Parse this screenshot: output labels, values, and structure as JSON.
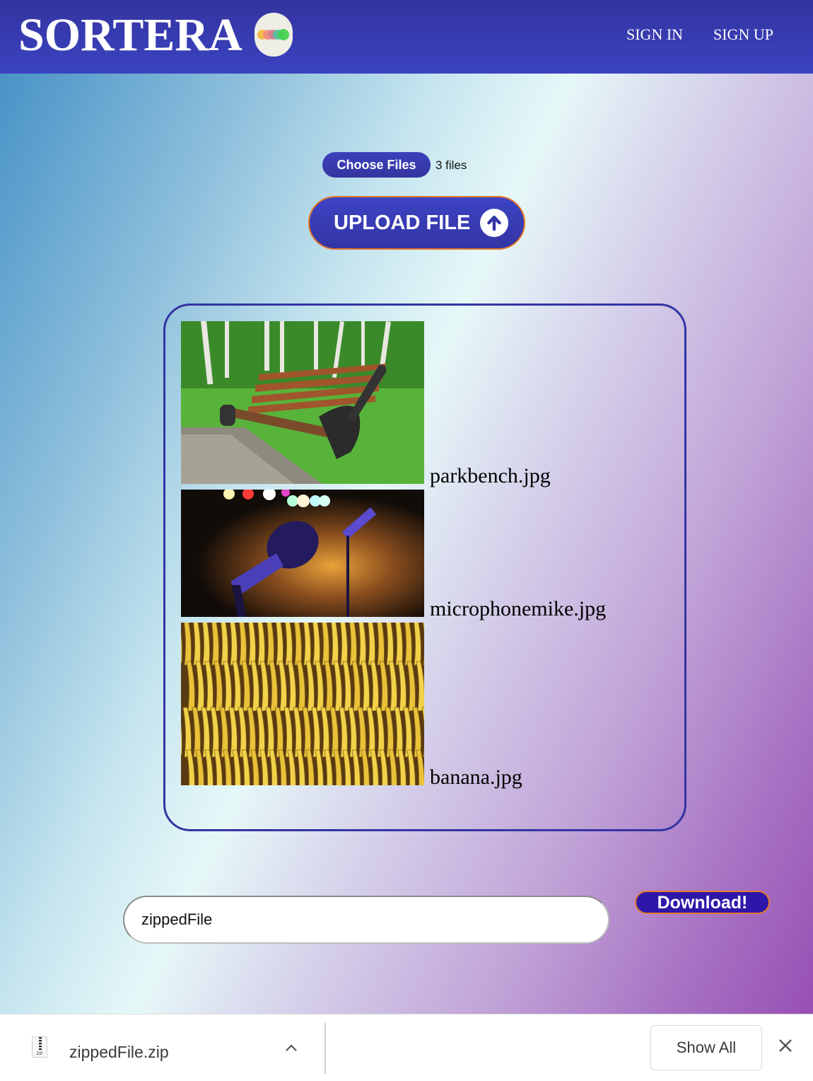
{
  "header": {
    "brand": "SORTERA",
    "logo_dot_colors": [
      "#f4b63a",
      "#ef8a7a",
      "#d47a8e",
      "#4cc3a0",
      "#3fcf4a"
    ],
    "nav": [
      {
        "label": "SIGN IN"
      },
      {
        "label": "SIGN UP"
      }
    ]
  },
  "upload": {
    "choose_label": "Choose Files",
    "files_status": "3 files",
    "upload_label": "UPLOAD FILE",
    "upload_icon": "arrow-up-circle-icon"
  },
  "gallery": {
    "items": [
      {
        "filename": "parkbench.jpg",
        "image": "park bench photo"
      },
      {
        "filename": "microphonemike.jpg",
        "image": "microphone on stage photo"
      },
      {
        "filename": "banana.jpg",
        "image": "bananas bunches photo"
      }
    ]
  },
  "download": {
    "zip_name_value": "zippedFile",
    "button_label": "Download!"
  },
  "download_bar": {
    "file_icon": "zip-file-icon",
    "file_icon_label": "ZIP",
    "filename": "zippedFile.zip",
    "chevron": "^",
    "show_all_label": "Show All",
    "close_glyph": "✕"
  },
  "colors": {
    "brand_blue": "#3434a3",
    "accent_orange": "#e87a2a",
    "download_purple": "#2e17a8"
  }
}
